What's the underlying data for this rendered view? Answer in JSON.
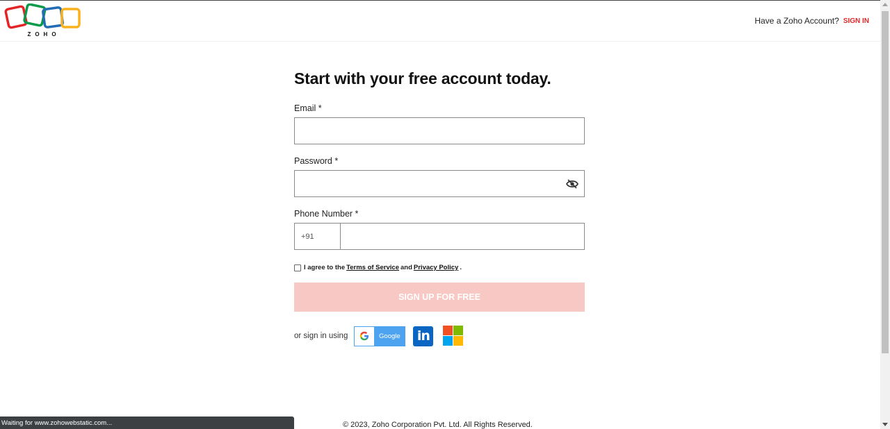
{
  "header": {
    "logo_text": "ZOHO",
    "have_account_text": "Have a Zoho Account?",
    "signin_label": "SIGN IN"
  },
  "form": {
    "title": "Start with your free account today.",
    "email_label": "Email *",
    "email_value": "",
    "password_label": "Password *",
    "password_value": "",
    "phone_label": "Phone Number *",
    "country_code": "+91",
    "phone_value": "",
    "agree_prefix": "I agree to the",
    "terms_label": "Terms of Service",
    "agree_and": "and",
    "privacy_label": "Privacy Policy",
    "agree_suffix": ".",
    "agree_checked": false,
    "signup_label": "SIGN UP FOR FREE"
  },
  "social": {
    "label": "or sign in using",
    "google_label": "Google",
    "linkedin_label": "in",
    "icons": [
      "google-icon",
      "linkedin-icon",
      "microsoft-icon"
    ]
  },
  "footer": {
    "copyright": "© 2023, Zoho Corporation Pvt. Ltd. All Rights Reserved."
  },
  "status_bar": {
    "text": "Waiting for www.zohowebstatic.com..."
  },
  "colors": {
    "brand_red": "#e42527",
    "signup_disabled_bg": "#f8c8c5",
    "google_blue": "#4ea3f0",
    "linkedin_blue": "#0a66c2",
    "ms_red": "#f25022",
    "ms_green": "#7fba00",
    "ms_blue": "#00a4ef",
    "ms_yellow": "#ffb900"
  }
}
